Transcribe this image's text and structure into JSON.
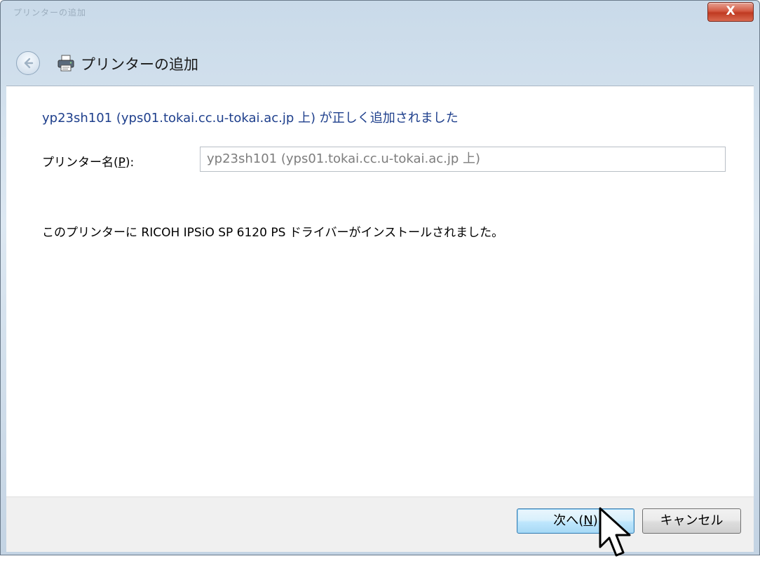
{
  "window": {
    "title_ghost": "プリンターの追加",
    "close_label": "X"
  },
  "nav": {
    "title": "プリンターの追加"
  },
  "content": {
    "headline": "yp23sh101 (yps01.tokai.cc.u-tokai.ac.jp 上) が正しく追加されました",
    "printer_name_label_pre": "プリンター名(",
    "printer_name_label_key": "P",
    "printer_name_label_post": "):",
    "printer_name_value": "yp23sh101 (yps01.tokai.cc.u-tokai.ac.jp 上)",
    "install_message": "このプリンターに RICOH IPSiO SP 6120 PS ドライバーがインストールされました。"
  },
  "footer": {
    "next_pre": "次へ(",
    "next_key": "N",
    "next_post": ")",
    "cancel_label": "キャンセル"
  },
  "icons": {
    "back": "back-arrow-icon",
    "printer": "printer-icon",
    "close": "close-icon",
    "cursor": "mouse-pointer-icon"
  },
  "colors": {
    "headline": "#1e3f8c",
    "close_button": "#c8442c",
    "next_button": "#bee6fd",
    "chrome": "#c9dae9"
  }
}
